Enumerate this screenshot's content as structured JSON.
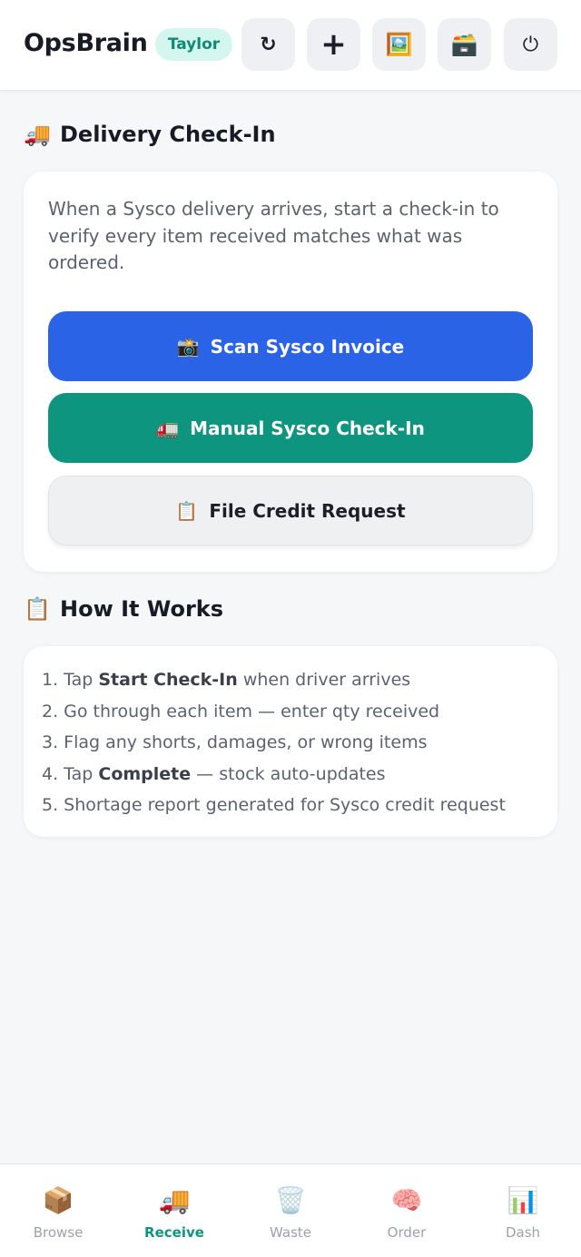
{
  "header": {
    "brand": "OpsBrain",
    "user": "Taylor",
    "buttons": [
      {
        "icon": "refresh-icon",
        "glyph": "↻"
      },
      {
        "icon": "plus-icon",
        "glyph": "+"
      },
      {
        "icon": "picture-icon",
        "glyph": "🖼️"
      },
      {
        "icon": "card-box-icon",
        "glyph": "🗃️"
      },
      {
        "icon": "power-icon",
        "glyph": "⏻"
      }
    ]
  },
  "delivery": {
    "emoji": "🚚",
    "title": "Delivery Check-In",
    "intro": "When a Sysco delivery arrives, start a check-in to verify every item received matches what was ordered.",
    "scan_emoji": "📸",
    "scan_label": "Scan Sysco Invoice",
    "manual_emoji": "🚛",
    "manual_label": "Manual Sysco Check-In",
    "credit_emoji": "📋",
    "credit_label": "File Credit Request"
  },
  "how": {
    "emoji": "📋",
    "title": "How It Works",
    "steps": [
      {
        "pre": "1. Tap ",
        "bold": "Start Check-In",
        "post": " when driver arrives"
      },
      {
        "pre": "2. Go through each item — enter qty received",
        "bold": "",
        "post": ""
      },
      {
        "pre": "3. Flag any shorts, damages, or wrong items",
        "bold": "",
        "post": ""
      },
      {
        "pre": "4. Tap ",
        "bold": "Complete",
        "post": " — stock auto-updates"
      },
      {
        "pre": "5. Shortage report generated for Sysco credit request",
        "bold": "",
        "post": ""
      }
    ]
  },
  "nav": {
    "items": [
      {
        "icon": "📦",
        "label": "Browse"
      },
      {
        "icon": "🚚",
        "label": "Receive"
      },
      {
        "icon": "🗑️",
        "label": "Waste"
      },
      {
        "icon": "🧠",
        "label": "Order"
      },
      {
        "icon": "📊",
        "label": "Dash"
      }
    ],
    "active": "Receive"
  },
  "colors": {
    "primary_blue": "#2a63e6",
    "teal": "#0e9580",
    "badge_bg": "#d3f6ee"
  }
}
